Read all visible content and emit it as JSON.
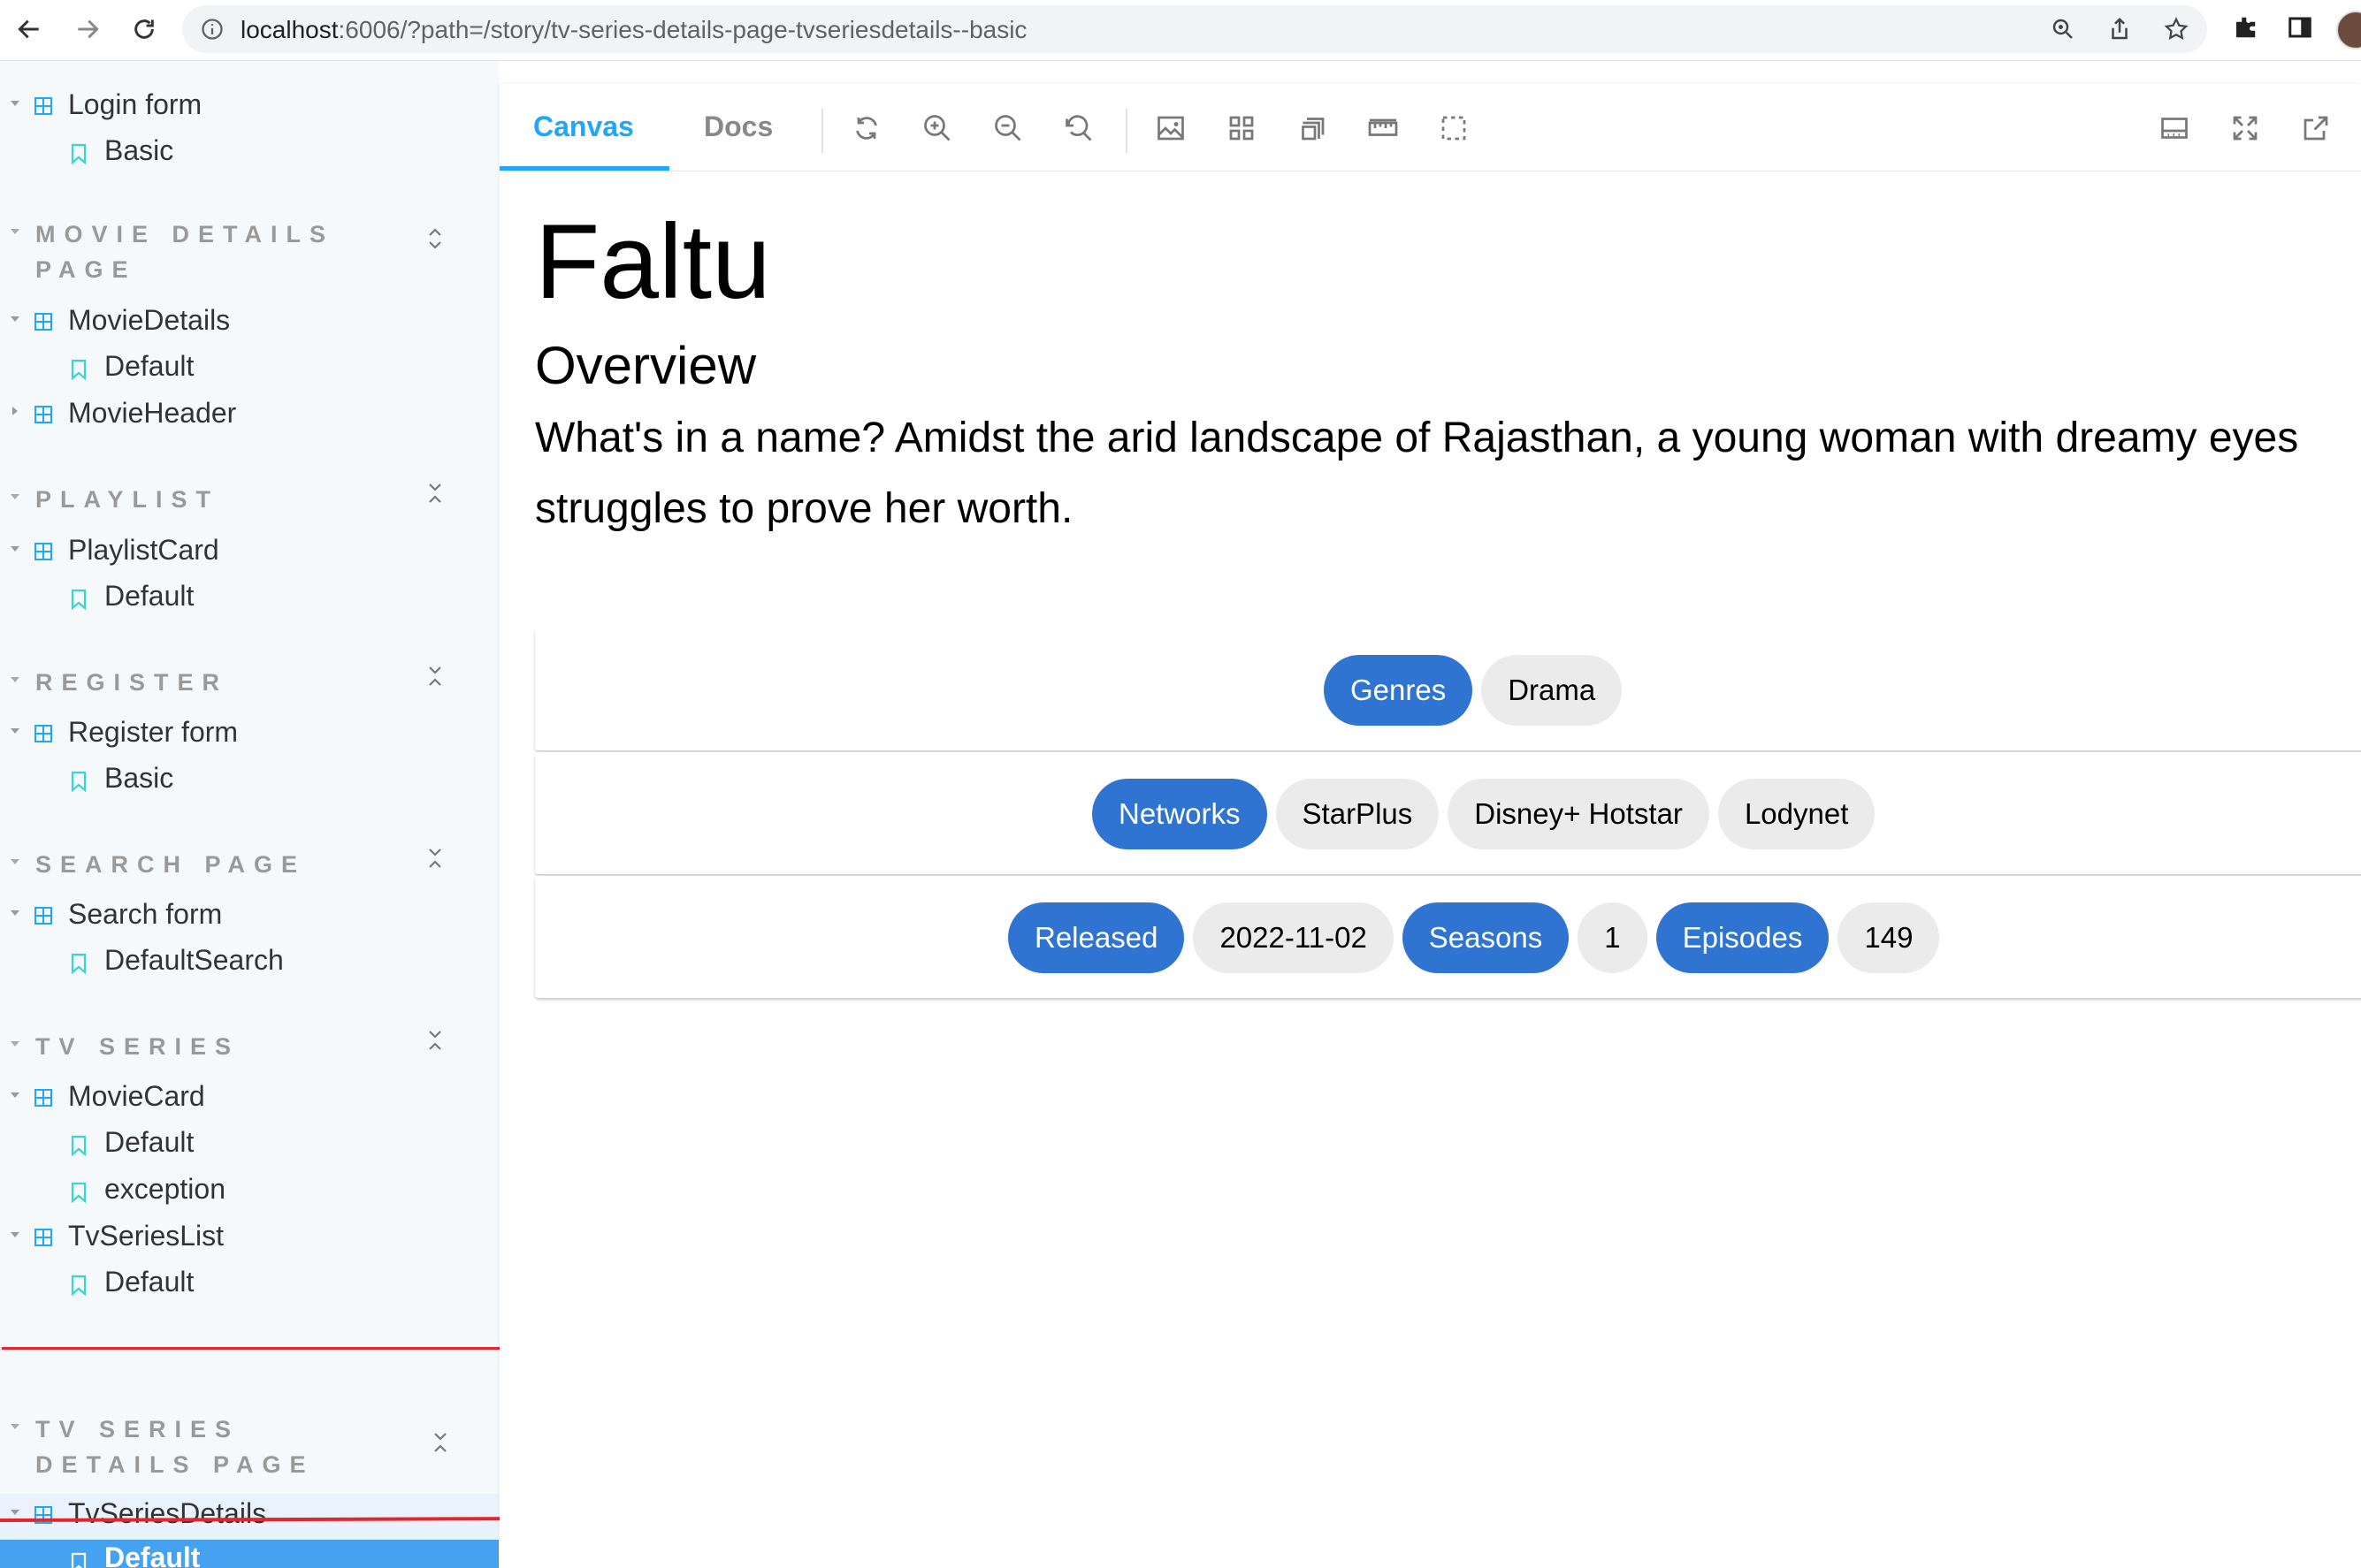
{
  "browser": {
    "url_host": "localhost",
    "url_rest": ":6006/?path=/story/tv-series-details-page-tvseriesdetails--basic"
  },
  "sidebar": {
    "items": [
      {
        "kind": "component",
        "label": "Login form"
      },
      {
        "kind": "story",
        "label": "Basic"
      },
      {
        "kind": "group",
        "label": "MOVIE DETAILS PAGE"
      },
      {
        "kind": "component",
        "label": "MovieDetails"
      },
      {
        "kind": "story",
        "label": "Default"
      },
      {
        "kind": "component",
        "label": "MovieHeader"
      },
      {
        "kind": "group",
        "label": "PLAYLIST"
      },
      {
        "kind": "component",
        "label": "PlaylistCard"
      },
      {
        "kind": "story",
        "label": "Default"
      },
      {
        "kind": "group",
        "label": "REGISTER"
      },
      {
        "kind": "component",
        "label": "Register form"
      },
      {
        "kind": "story",
        "label": "Basic"
      },
      {
        "kind": "group",
        "label": "SEARCH PAGE"
      },
      {
        "kind": "component",
        "label": "Search form"
      },
      {
        "kind": "story",
        "label": "DefaultSearch"
      },
      {
        "kind": "group",
        "label": "TV SERIES"
      },
      {
        "kind": "component",
        "label": "MovieCard"
      },
      {
        "kind": "story",
        "label": "Default"
      },
      {
        "kind": "story",
        "label": "exception"
      },
      {
        "kind": "component",
        "label": "TvSeriesList"
      },
      {
        "kind": "story",
        "label": "Default"
      },
      {
        "kind": "group",
        "label": "TV SERIES DETAILS PAGE"
      },
      {
        "kind": "component",
        "label": "TvSeriesDetails"
      },
      {
        "kind": "story",
        "label": "Default",
        "selected": true
      }
    ]
  },
  "toolbar": {
    "tabs": [
      {
        "label": "Canvas",
        "active": true
      },
      {
        "label": "Docs",
        "active": false
      }
    ]
  },
  "story": {
    "title": "Faltu",
    "overview_heading": "Overview",
    "overview_text": "What's in a name? Amidst the arid landscape of Rajasthan, a young woman with dreamy eyes struggles to prove her worth.",
    "genres": {
      "label": "Genres",
      "values": [
        "Drama"
      ]
    },
    "networks": {
      "label": "Networks",
      "values": [
        "StarPlus",
        "Disney+ Hotstar",
        "Lodynet"
      ]
    },
    "released": {
      "label": "Released",
      "value": "2022-11-02"
    },
    "seasons": {
      "label": "Seasons",
      "value": "1"
    },
    "episodes": {
      "label": "Episodes",
      "value": "149"
    }
  },
  "colors": {
    "accent": "#1ea7fd",
    "selected_bg": "#45a2f0",
    "chip_primary": "#2f74d0",
    "chip_secondary": "#ebebeb",
    "annotation": "#e3262e"
  }
}
